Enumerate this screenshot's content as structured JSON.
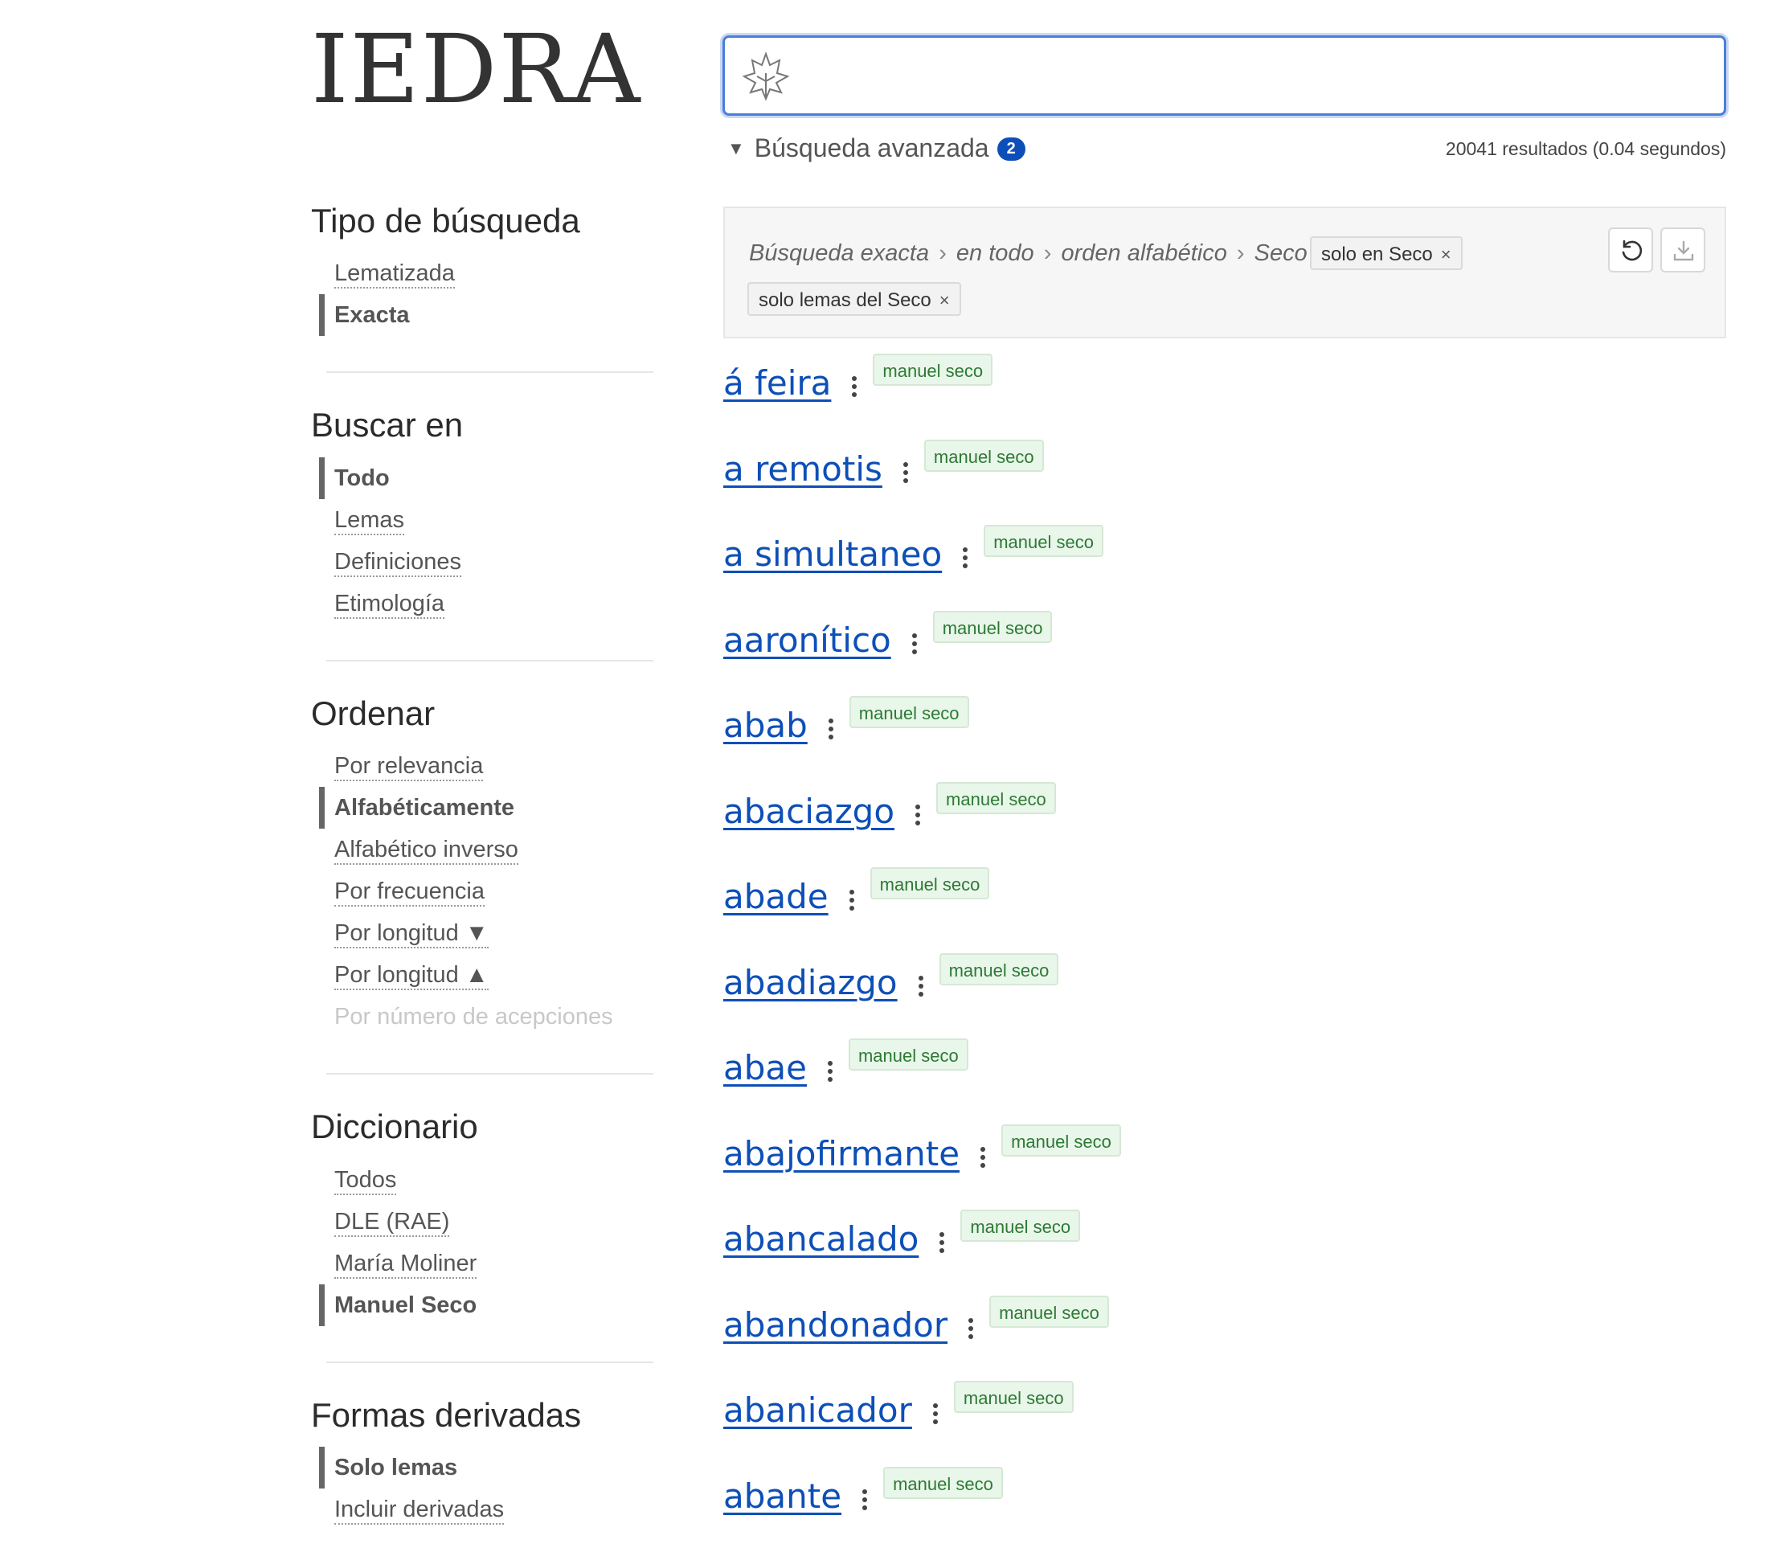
{
  "logo": "IEDRA",
  "search": {
    "value": "",
    "placeholder": ""
  },
  "advanced": {
    "label": "Búsqueda avanzada",
    "badge": "2"
  },
  "results_count": "20041 resultados (0.04 segundos)",
  "filter": {
    "crumbs": [
      "Búsqueda exacta",
      "en todo",
      "orden alfabético",
      "Seco"
    ],
    "sep": "›",
    "chips": [
      "solo en Seco",
      "solo lemas del Seco"
    ],
    "chip_close": "×"
  },
  "sidebar": {
    "tipo": {
      "title": "Tipo de búsqueda",
      "options": [
        "Lematizada",
        "Exacta"
      ]
    },
    "buscar": {
      "title": "Buscar en",
      "options": [
        "Todo",
        "Lemas",
        "Definiciones",
        "Etimología"
      ]
    },
    "ordenar": {
      "title": "Ordenar",
      "options": [
        "Por relevancia",
        "Alfabéticamente",
        "Alfabético inverso",
        "Por frecuencia",
        "Por longitud ▼",
        "Por longitud ▲",
        "Por número de acepciones"
      ]
    },
    "diccionario": {
      "title": "Diccionario",
      "options": [
        "Todos",
        "DLE (RAE)",
        "María Moliner",
        "Manuel Seco"
      ]
    },
    "formas": {
      "title": "Formas derivadas",
      "options": [
        "Solo lemas",
        "Incluir derivadas"
      ]
    }
  },
  "results": [
    {
      "word": "á feira",
      "tag": "manuel seco"
    },
    {
      "word": "a remotis",
      "tag": "manuel seco"
    },
    {
      "word": "a simultaneo",
      "tag": "manuel seco"
    },
    {
      "word": "aaronítico",
      "tag": "manuel seco"
    },
    {
      "word": "abab",
      "tag": "manuel seco"
    },
    {
      "word": "abaciazgo",
      "tag": "manuel seco"
    },
    {
      "word": "abade",
      "tag": "manuel seco"
    },
    {
      "word": "abadiazgo",
      "tag": "manuel seco"
    },
    {
      "word": "abae",
      "tag": "manuel seco"
    },
    {
      "word": "abajofirmante",
      "tag": "manuel seco"
    },
    {
      "word": "abancalado",
      "tag": "manuel seco"
    },
    {
      "word": "abandonador",
      "tag": "manuel seco"
    },
    {
      "word": "abanicador",
      "tag": "manuel seco"
    },
    {
      "word": "abante",
      "tag": "manuel seco"
    }
  ],
  "icons": {
    "search": "ivy-leaf-icon",
    "reset": "reset-icon",
    "download": "download-icon",
    "more": "kebab-icon"
  },
  "colors": {
    "link": "#0d4fb8",
    "tag_bg": "#e9f6ea",
    "tag_text": "#2d7a34",
    "focus": "#4a7fd6"
  }
}
